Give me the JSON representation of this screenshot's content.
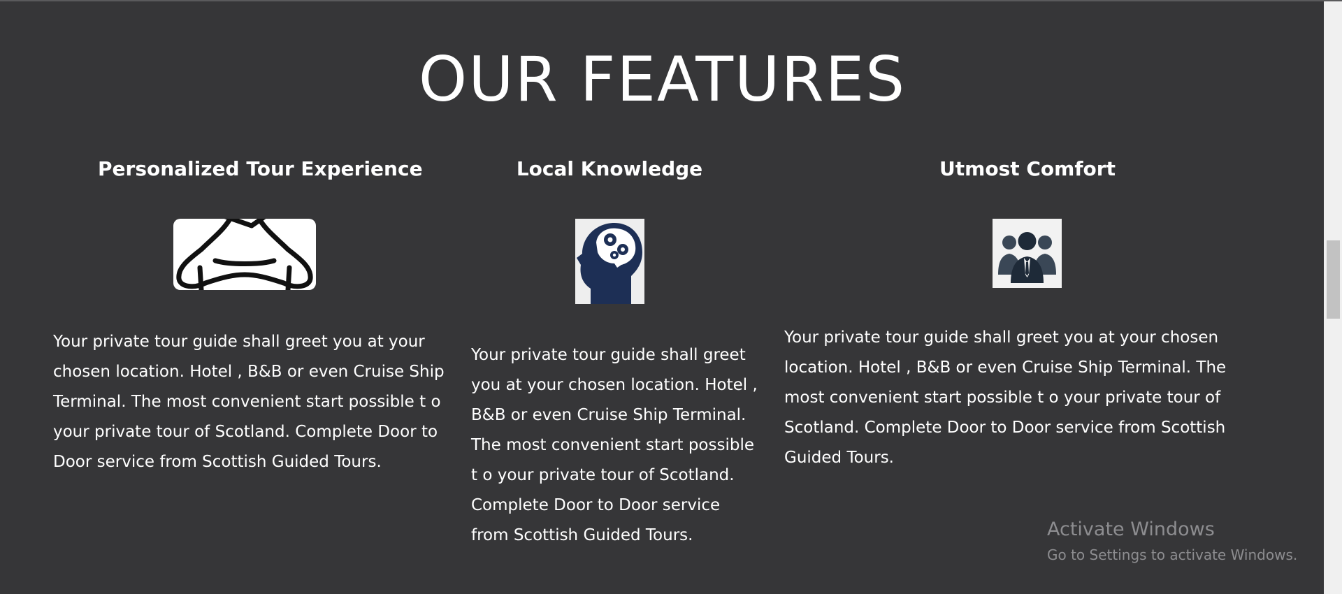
{
  "section": {
    "title": "OUR FEATURES"
  },
  "features": [
    {
      "title": "Personalized Tour Experience",
      "icon": "meditation-figure-icon",
      "text": "Your private tour guide shall greet you at your chosen location. Hotel , B&B or even Cruise Ship Terminal. The most convenient start possible t o your private tour of Scotland. Complete Door to Door service from Scottish Guided Tours."
    },
    {
      "title": "Local Knowledge",
      "icon": "brain-gears-icon",
      "text": "Your private tour guide shall greet you at your chosen location. Hotel , B&B or even Cruise Ship Terminal. The most convenient start possible t o your private tour of Scotland. Complete Door to Door service from Scottish Guided Tours."
    },
    {
      "title": "Utmost Comfort",
      "icon": "business-team-icon",
      "text": "Your private tour guide shall greet you at your chosen location. Hotel , B&B or even Cruise Ship Terminal. The most convenient start possible t o your private tour of Scotland. Complete Door to Door service from Scottish Guided Tours."
    }
  ],
  "watermark": {
    "title": "Activate Windows",
    "subtitle": "Go to Settings to activate Windows."
  },
  "colors": {
    "background": "#363638",
    "text": "#ffffff",
    "icon_navy": "#1d2f55",
    "icon_slate": "#3a4756"
  }
}
